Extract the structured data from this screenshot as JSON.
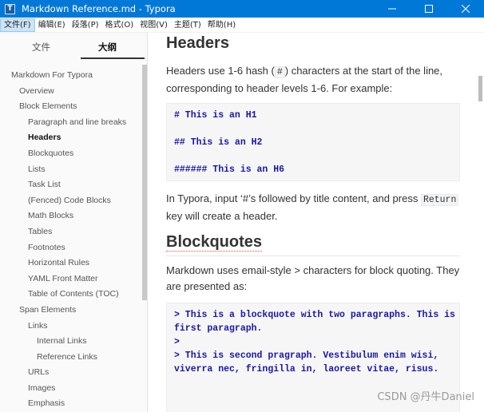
{
  "window": {
    "title": "Markdown Reference.md - Typora",
    "icon_label": "T",
    "icons": {
      "minimize": "minimize-icon",
      "maximize": "maximize-icon",
      "close": "close-icon"
    }
  },
  "menu": [
    "文件(F)",
    "编辑(E)",
    "段落(P)",
    "格式(O)",
    "视图(V)",
    "主题(T)",
    "帮助(H)"
  ],
  "sidebar": {
    "tabs": [
      "文件",
      "大纲"
    ],
    "active_tab": "大纲",
    "outline": [
      {
        "label": "Markdown For Typora",
        "level": 0
      },
      {
        "label": "Overview",
        "level": 1
      },
      {
        "label": "Block Elements",
        "level": 1
      },
      {
        "label": "Paragraph and line breaks",
        "level": 2
      },
      {
        "label": "Headers",
        "level": 2,
        "active": true
      },
      {
        "label": "Blockquotes",
        "level": 2
      },
      {
        "label": "Lists",
        "level": 2
      },
      {
        "label": "Task List",
        "level": 2
      },
      {
        "label": "(Fenced) Code Blocks",
        "level": 2
      },
      {
        "label": "Math Blocks",
        "level": 2
      },
      {
        "label": "Tables",
        "level": 2
      },
      {
        "label": "Footnotes",
        "level": 2
      },
      {
        "label": "Horizontal Rules",
        "level": 2
      },
      {
        "label": "YAML Front Matter",
        "level": 2
      },
      {
        "label": "Table of Contents (TOC)",
        "level": 2
      },
      {
        "label": "Span Elements",
        "level": 1
      },
      {
        "label": "Links",
        "level": 2
      },
      {
        "label": "Internal Links",
        "level": 3
      },
      {
        "label": "Reference Links",
        "level": 3
      },
      {
        "label": "URLs",
        "level": 2
      },
      {
        "label": "Images",
        "level": 2
      },
      {
        "label": "Emphasis",
        "level": 2
      }
    ]
  },
  "document": {
    "headers_title": "Headers",
    "headers_para_1": "Headers use 1-6 hash (",
    "headers_para_hash": "#",
    "headers_para_2": ") characters at the start of the line,",
    "headers_para_3": "corresponding to header levels 1-6. For example:",
    "code_headers": [
      "# This is an H1",
      "## This is an H2",
      "###### This is an H6"
    ],
    "typora_para_1": "In Typora, input ‘#’s followed by title content, and press ",
    "typora_para_key": "Return",
    "typora_para_2": "key will create a header.",
    "blockquotes_title": "Blockquotes",
    "bq_para_1": "Markdown uses email-style > characters for block quoting. They",
    "bq_para_2": "are presented as:",
    "code_bq": [
      "> This is a blockquote with two paragraphs. This is",
      "first paragraph.",
      ">",
      "> This is second pragraph. Vestibulum enim wisi,",
      "viverra nec, fringilla in, laoreet vitae, risus."
    ]
  },
  "watermark": "CSDN @丹牛Daniel"
}
